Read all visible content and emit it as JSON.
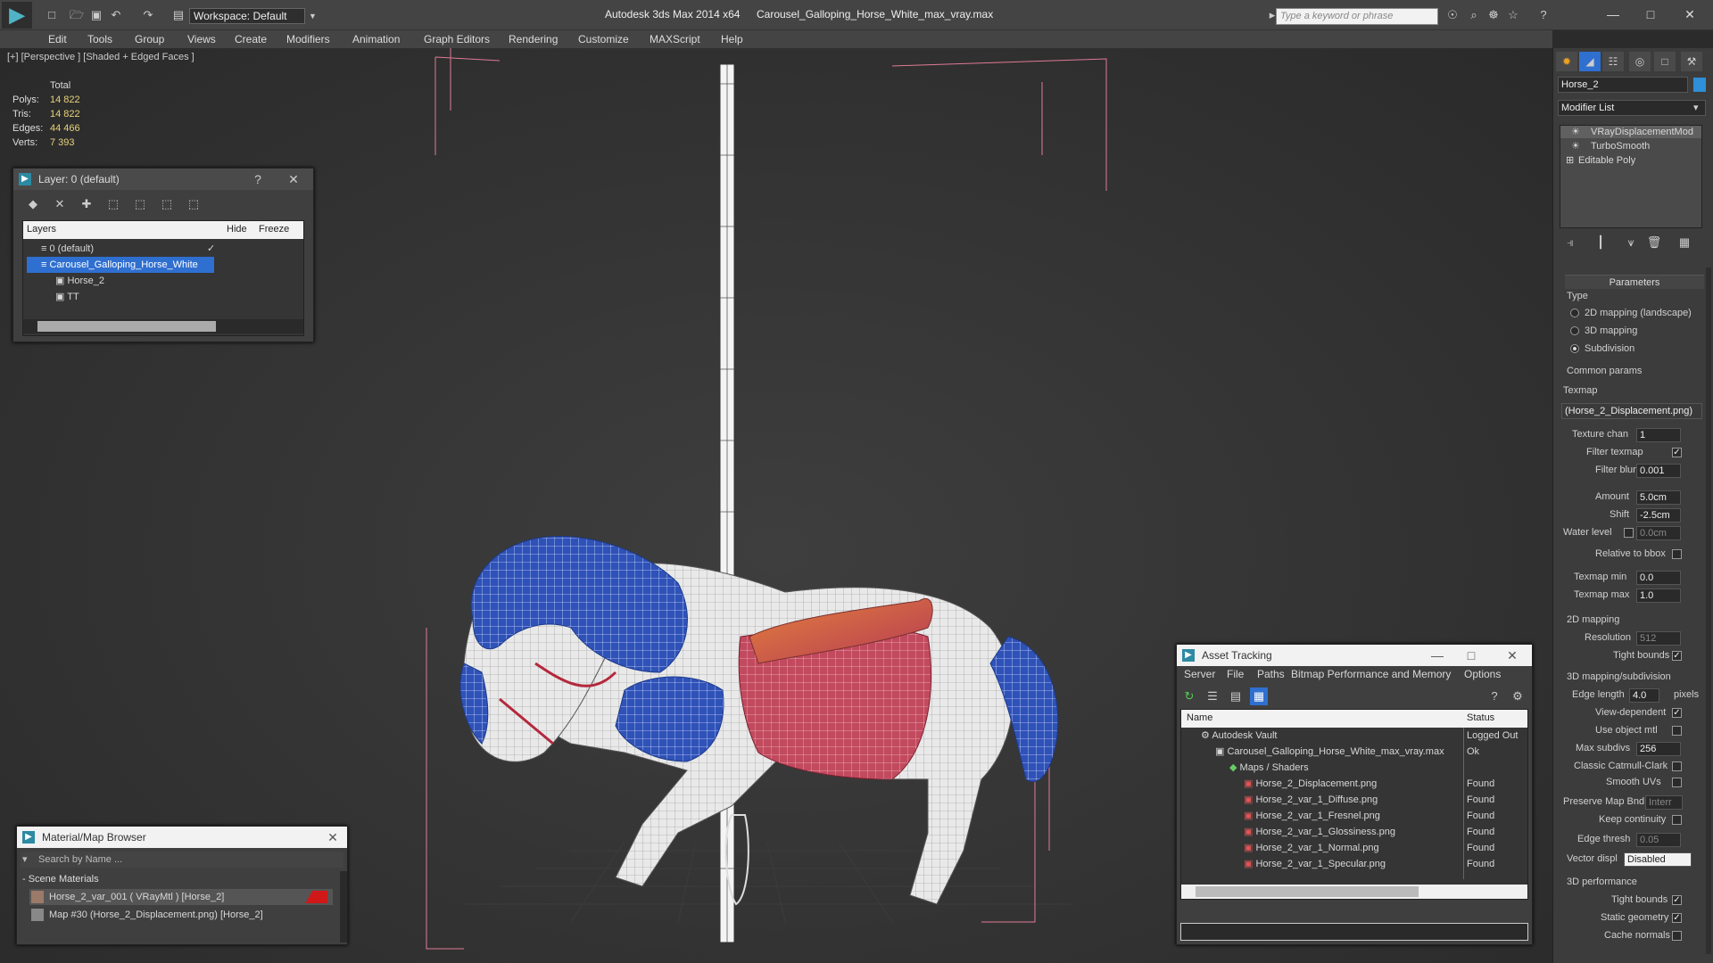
{
  "titlebar": {
    "workspace": "Workspace: Default",
    "app_title": "Autodesk 3ds Max 2014 x64",
    "file_title": "Carousel_Galloping_Horse_White_max_vray.max",
    "search_placeholder": "Type a keyword or phrase"
  },
  "menu": [
    "Edit",
    "Tools",
    "Group",
    "Views",
    "Create",
    "Modifiers",
    "Animation",
    "Graph Editors",
    "Rendering",
    "Customize",
    "MAXScript",
    "Help"
  ],
  "viewport": {
    "label": "[+] [Perspective ] [Shaded + Edged Faces ]",
    "stats": {
      "header": "Total",
      "rows": [
        {
          "k": "Polys:",
          "v": "14 822"
        },
        {
          "k": "Tris:",
          "v": "14 822"
        },
        {
          "k": "Edges:",
          "v": "44 466"
        },
        {
          "k": "Verts:",
          "v": "7 393"
        }
      ]
    }
  },
  "layer_window": {
    "title": "Layer: 0 (default)",
    "help": "?",
    "columns": {
      "layers": "Layers",
      "hide": "Hide",
      "freeze": "Freeze"
    },
    "rows": [
      {
        "name": "0 (default)",
        "checked": "✓"
      },
      {
        "name": "Carousel_Galloping_Horse_White"
      },
      {
        "name": "Horse_2"
      },
      {
        "name": "TT"
      }
    ]
  },
  "material_browser": {
    "title": "Material/Map Browser",
    "search_placeholder": "Search by Name ...",
    "group": "- Scene Materials",
    "items": [
      {
        "label": "Horse_2_var_001  ( VRayMtl ) [Horse_2]"
      },
      {
        "label": "Map #30 (Horse_2_Displacement.png) [Horse_2]"
      }
    ]
  },
  "asset_tracking": {
    "title": "Asset Tracking",
    "menu": [
      "Server",
      "File",
      "Paths",
      "Bitmap Performance and Memory",
      "Options"
    ],
    "columns": {
      "name": "Name",
      "status": "Status"
    },
    "rows": [
      {
        "name": "Autodesk Vault",
        "status": "Logged Out"
      },
      {
        "name": "Carousel_Galloping_Horse_White_max_vray.max",
        "status": "Ok"
      },
      {
        "name": "Maps / Shaders",
        "status": ""
      },
      {
        "name": "Horse_2_Displacement.png",
        "status": "Found"
      },
      {
        "name": "Horse_2_var_1_Diffuse.png",
        "status": "Found"
      },
      {
        "name": "Horse_2_var_1_Fresnel.png",
        "status": "Found"
      },
      {
        "name": "Horse_2_var_1_Glossiness.png",
        "status": "Found"
      },
      {
        "name": "Horse_2_var_1_Normal.png",
        "status": "Found"
      },
      {
        "name": "Horse_2_var_1_Specular.png",
        "status": "Found"
      }
    ]
  },
  "command_panel": {
    "object_name": "Horse_2",
    "modifier_list": "Modifier List",
    "stack": [
      "VRayDisplacementMod",
      "TurboSmooth",
      "Editable Poly"
    ],
    "parameters_title": "Parameters",
    "type_label": "Type",
    "type_options": [
      "2D mapping (landscape)",
      "3D mapping",
      "Subdivision"
    ],
    "common_params": "Common params",
    "texmap_label": "Texmap",
    "texmap_value": "(Horse_2_Displacement.png)",
    "texture_chan": {
      "label": "Texture chan",
      "value": "1"
    },
    "filter_texmap": "Filter texmap",
    "filter_blur": {
      "label": "Filter blur",
      "value": "0.001"
    },
    "amount": {
      "label": "Amount",
      "value": "5.0cm"
    },
    "shift": {
      "label": "Shift",
      "value": "-2.5cm"
    },
    "water_level": {
      "label": "Water level",
      "value": "0.0cm"
    },
    "relative_bbox": "Relative to bbox",
    "texmap_min": {
      "label": "Texmap min",
      "value": "0.0"
    },
    "texmap_max": {
      "label": "Texmap max",
      "value": "1.0"
    },
    "mapping2d": "2D mapping",
    "resolution": {
      "label": "Resolution",
      "value": "512"
    },
    "tight_bounds": "Tight bounds",
    "mapping3d": "3D mapping/subdivision",
    "edge_length": {
      "label": "Edge length",
      "value": "4.0",
      "unit": "pixels"
    },
    "view_dependent": "View-dependent",
    "use_object_mtl": "Use object mtl",
    "max_subdivs": {
      "label": "Max subdivs",
      "value": "256"
    },
    "catmull": "Classic Catmull-Clark",
    "smooth_uvs": "Smooth UVs",
    "preserve_map": {
      "label": "Preserve Map Bnd",
      "value": "Interr"
    },
    "keep_continuity": "Keep continuity",
    "edge_thresh": {
      "label": "Edge thresh",
      "value": "0.05"
    },
    "vector_displ": {
      "label": "Vector displ",
      "value": "Disabled"
    },
    "perf_title": "3D performance",
    "perf_tight": "Tight bounds",
    "static_geom": "Static geometry",
    "cache_normals": "Cache normals"
  },
  "colors": {
    "accent": "#2f6fd0",
    "stats_value": "#e8d37a",
    "bbox": "#e07a96"
  }
}
